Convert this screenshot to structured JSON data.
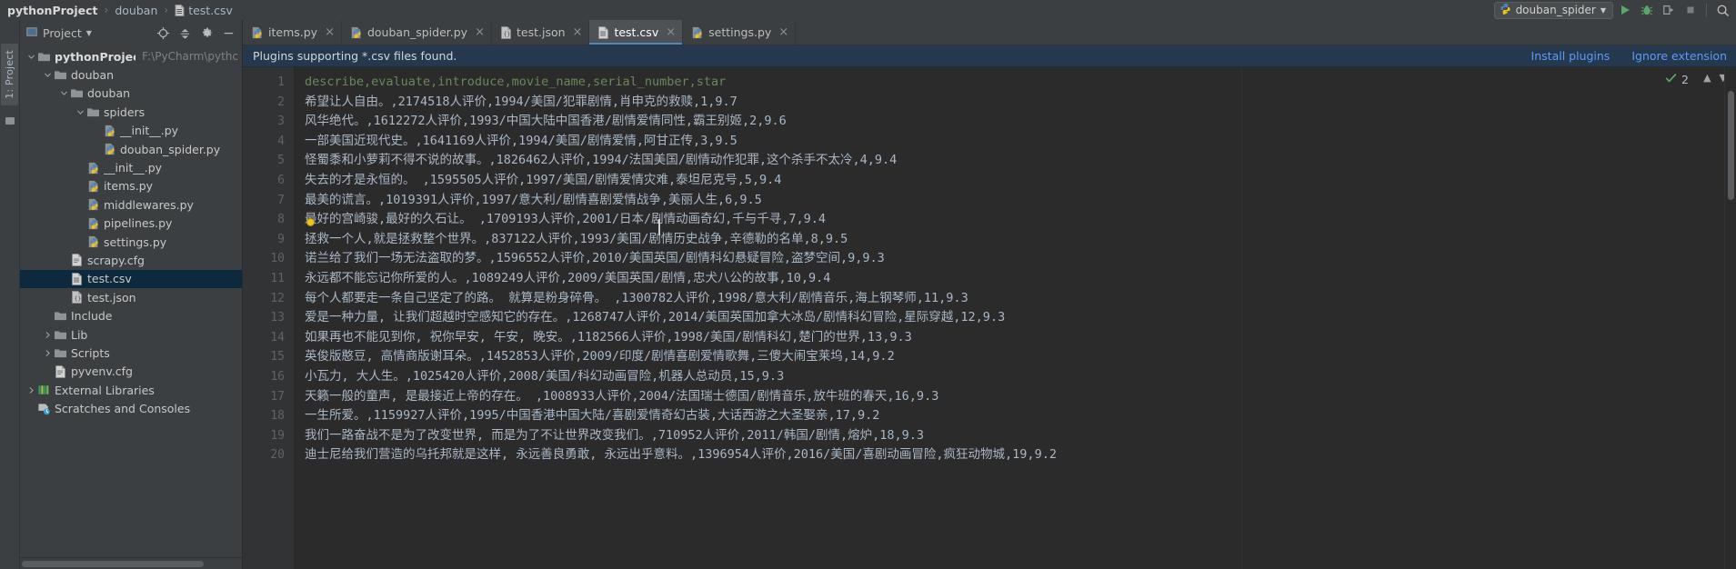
{
  "window": {
    "breadcrumb": [
      {
        "label": "pythonProject",
        "bold": true,
        "icon": "none"
      },
      {
        "label": "douban",
        "bold": false,
        "icon": "none"
      },
      {
        "label": "test.csv",
        "bold": false,
        "icon": "csv-file-icon"
      }
    ],
    "run_config": {
      "label": "douban_spider",
      "icon": "python-file-icon"
    },
    "toolbar_icons": [
      "run-icon",
      "debug-icon",
      "run-with-coverage-icon",
      "stop-icon",
      "search-everywhere-icon"
    ]
  },
  "left_strip": {
    "tool_tab": "1: Project"
  },
  "project_panel": {
    "title": "Project",
    "header_buttons": [
      "locate-icon",
      "collapse-all-icon",
      "settings-gear-icon",
      "hide-icon"
    ],
    "tree": [
      {
        "depth": 0,
        "arrow": "down",
        "icon": "folder-icon",
        "label": "pythonProject",
        "bold": true,
        "sub": "F:\\PyCharm\\pythc",
        "selected": false
      },
      {
        "depth": 1,
        "arrow": "down",
        "icon": "folder-icon",
        "label": "douban",
        "bold": false,
        "sub": "",
        "selected": false
      },
      {
        "depth": 2,
        "arrow": "down",
        "icon": "folder-icon",
        "label": "douban",
        "bold": false,
        "sub": "",
        "selected": false
      },
      {
        "depth": 3,
        "arrow": "down",
        "icon": "folder-icon",
        "label": "spiders",
        "bold": false,
        "sub": "",
        "selected": false
      },
      {
        "depth": 4,
        "arrow": "none",
        "icon": "python-file-icon",
        "label": "__init__.py",
        "bold": false,
        "sub": "",
        "selected": false
      },
      {
        "depth": 4,
        "arrow": "none",
        "icon": "python-file-icon",
        "label": "douban_spider.py",
        "bold": false,
        "sub": "",
        "selected": false
      },
      {
        "depth": 3,
        "arrow": "none",
        "icon": "python-file-icon",
        "label": "__init__.py",
        "bold": false,
        "sub": "",
        "selected": false
      },
      {
        "depth": 3,
        "arrow": "none",
        "icon": "python-file-icon",
        "label": "items.py",
        "bold": false,
        "sub": "",
        "selected": false
      },
      {
        "depth": 3,
        "arrow": "none",
        "icon": "python-file-icon",
        "label": "middlewares.py",
        "bold": false,
        "sub": "",
        "selected": false
      },
      {
        "depth": 3,
        "arrow": "none",
        "icon": "python-file-icon",
        "label": "pipelines.py",
        "bold": false,
        "sub": "",
        "selected": false
      },
      {
        "depth": 3,
        "arrow": "none",
        "icon": "python-file-icon",
        "label": "settings.py",
        "bold": false,
        "sub": "",
        "selected": false
      },
      {
        "depth": 2,
        "arrow": "none",
        "icon": "text-file-icon",
        "label": "scrapy.cfg",
        "bold": false,
        "sub": "",
        "selected": false
      },
      {
        "depth": 2,
        "arrow": "none",
        "icon": "csv-file-icon",
        "label": "test.csv",
        "bold": false,
        "sub": "",
        "selected": true
      },
      {
        "depth": 2,
        "arrow": "none",
        "icon": "json-file-icon",
        "label": "test.json",
        "bold": false,
        "sub": "",
        "selected": false
      },
      {
        "depth": 1,
        "arrow": "none",
        "icon": "folder-icon",
        "label": "Include",
        "bold": false,
        "sub": "",
        "selected": false
      },
      {
        "depth": 1,
        "arrow": "right",
        "icon": "folder-icon",
        "label": "Lib",
        "bold": false,
        "sub": "",
        "selected": false
      },
      {
        "depth": 1,
        "arrow": "right",
        "icon": "folder-icon",
        "label": "Scripts",
        "bold": false,
        "sub": "",
        "selected": false
      },
      {
        "depth": 1,
        "arrow": "none",
        "icon": "text-file-icon",
        "label": "pyvenv.cfg",
        "bold": false,
        "sub": "",
        "selected": false
      },
      {
        "depth": 0,
        "arrow": "right",
        "icon": "libraries-icon",
        "label": "External Libraries",
        "bold": false,
        "sub": "",
        "selected": false
      },
      {
        "depth": 0,
        "arrow": "none",
        "icon": "scratches-icon",
        "label": "Scratches and Consoles",
        "bold": false,
        "sub": "",
        "selected": false
      }
    ]
  },
  "editor": {
    "tabs": [
      {
        "label": "items.py",
        "icon": "python-file-icon",
        "active": false
      },
      {
        "label": "douban_spider.py",
        "icon": "python-file-icon",
        "active": false
      },
      {
        "label": "test.json",
        "icon": "json-file-icon",
        "active": false
      },
      {
        "label": "test.csv",
        "icon": "csv-file-icon",
        "active": true
      },
      {
        "label": "settings.py",
        "icon": "python-file-icon",
        "active": false
      }
    ],
    "notification": {
      "message": "Plugins supporting *.csv files found.",
      "install_label": "Install plugins",
      "ignore_label": "Ignore extension"
    },
    "inspection": {
      "count": "2",
      "icon": "inspection-check-icon"
    },
    "line_numbers": [
      "1",
      "2",
      "3",
      "4",
      "5",
      "6",
      "7",
      "8",
      "9",
      "10",
      "11",
      "12",
      "13",
      "14",
      "15",
      "16",
      "17",
      "18",
      "19",
      "20"
    ],
    "lines": [
      "describe,evaluate,introduce,movie_name,serial_number,star",
      "希望让人自由。,2174518人评价,1994/美国/犯罪剧情,肖申克的救赎,1,9.7",
      "风华绝代。,1612272人评价,1993/中国大陆中国香港/剧情爱情同性,霸王别姬,2,9.6",
      "一部美国近现代史。,1641169人评价,1994/美国/剧情爱情,阿甘正传,3,9.5",
      "怪蜀黍和小萝莉不得不说的故事。,1826462人评价,1994/法国美国/剧情动作犯罪,这个杀手不太冷,4,9.4",
      "失去的才是永恒的。 ,1595505人评价,1997/美国/剧情爱情灾难,泰坦尼克号,5,9.4",
      "最美的谎言。,1019391人评价,1997/意大利/剧情喜剧爱情战争,美丽人生,6,9.5",
      "最好的宫崎骏,最好的久石让。 ,1709193人评价,2001/日本/剧情动画奇幻,千与千寻,7,9.4",
      "拯救一个人,就是拯救整个世界。,837122人评价,1993/美国/剧情历史战争,辛德勒的名单,8,9.5",
      "诺兰给了我们一场无法盗取的梦。,1596552人评价,2010/美国英国/剧情科幻悬疑冒险,盗梦空间,9,9.3",
      "永远都不能忘记你所爱的人。,1089249人评价,2009/美国英国/剧情,忠犬八公的故事,10,9.4",
      "每个人都要走一条自己坚定了的路。 就算是粉身碎骨。 ,1300782人评价,1998/意大利/剧情音乐,海上钢琴师,11,9.3",
      "爱是一种力量, 让我们超越时空感知它的存在。,1268747人评价,2014/美国英国加拿大冰岛/剧情科幻冒险,星际穿越,12,9.3",
      "如果再也不能见到你, 祝你早安, 午安, 晚安。,1182566人评价,1998/美国/剧情科幻,楚门的世界,13,9.3",
      "英俊版憨豆, 高情商版谢耳朵。,1452853人评价,2009/印度/剧情喜剧爱情歌舞,三傻大闹宝莱坞,14,9.2",
      "小瓦力, 大人生。,1025420人评价,2008/美国/科幻动画冒险,机器人总动员,15,9.3",
      "天籁一般的童声, 是最接近上帝的存在。 ,1008933人评价,2004/法国瑞士德国/剧情音乐,放牛班的春天,16,9.3",
      "一生所爱。,1159927人评价,1995/中国香港中国大陆/喜剧爱情奇幻古装,大话西游之大圣娶亲,17,9.2",
      "我们一路奋战不是为了改变世界, 而是为了不让世界改变我们。,710952人评价,2011/韩国/剧情,熔炉,18,9.3",
      "迪士尼给我们营造的乌托邦就是这样, 永远善良勇敢, 永远出乎意料。,1396954人评价,2016/美国/喜剧动画冒险,疯狂动物城,19,9.2"
    ]
  },
  "colors": {
    "accent_blue": "#4a88c7",
    "link_blue": "#589df6",
    "notification_bg": "#25384e",
    "selection_bg": "#0d293e",
    "editor_bg": "#2b2b2b",
    "panel_bg": "#3c3f41",
    "csv_header_green": "#6a8759"
  }
}
